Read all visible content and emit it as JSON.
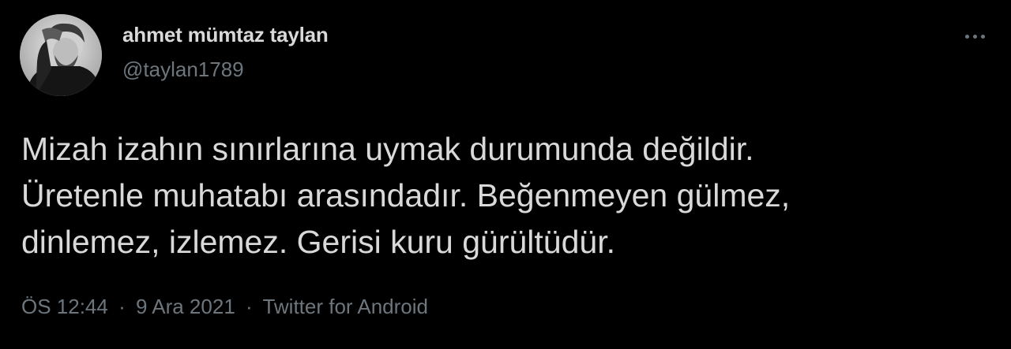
{
  "author": {
    "display_name": "ahmet mümtaz taylan",
    "handle": "@taylan1789",
    "avatar_icon": "profile-photo-icon"
  },
  "more_icon": "more-options-icon",
  "tweet": {
    "lines": [
      "Mizah izahın sınırlarına uymak durumunda değildir.",
      "Üretenle muhatabı arasındadır. Beğenmeyen gülmez,",
      "dinlemez, izlemez. Gerisi kuru gürültüdür."
    ]
  },
  "meta": {
    "time": "ÖS 12:44",
    "separator": "·",
    "date": "9 Ara 2021",
    "source": "Twitter for Android"
  },
  "colors": {
    "background": "#000000",
    "text_primary": "#d9d9d9",
    "text_secondary": "#6e767d"
  }
}
